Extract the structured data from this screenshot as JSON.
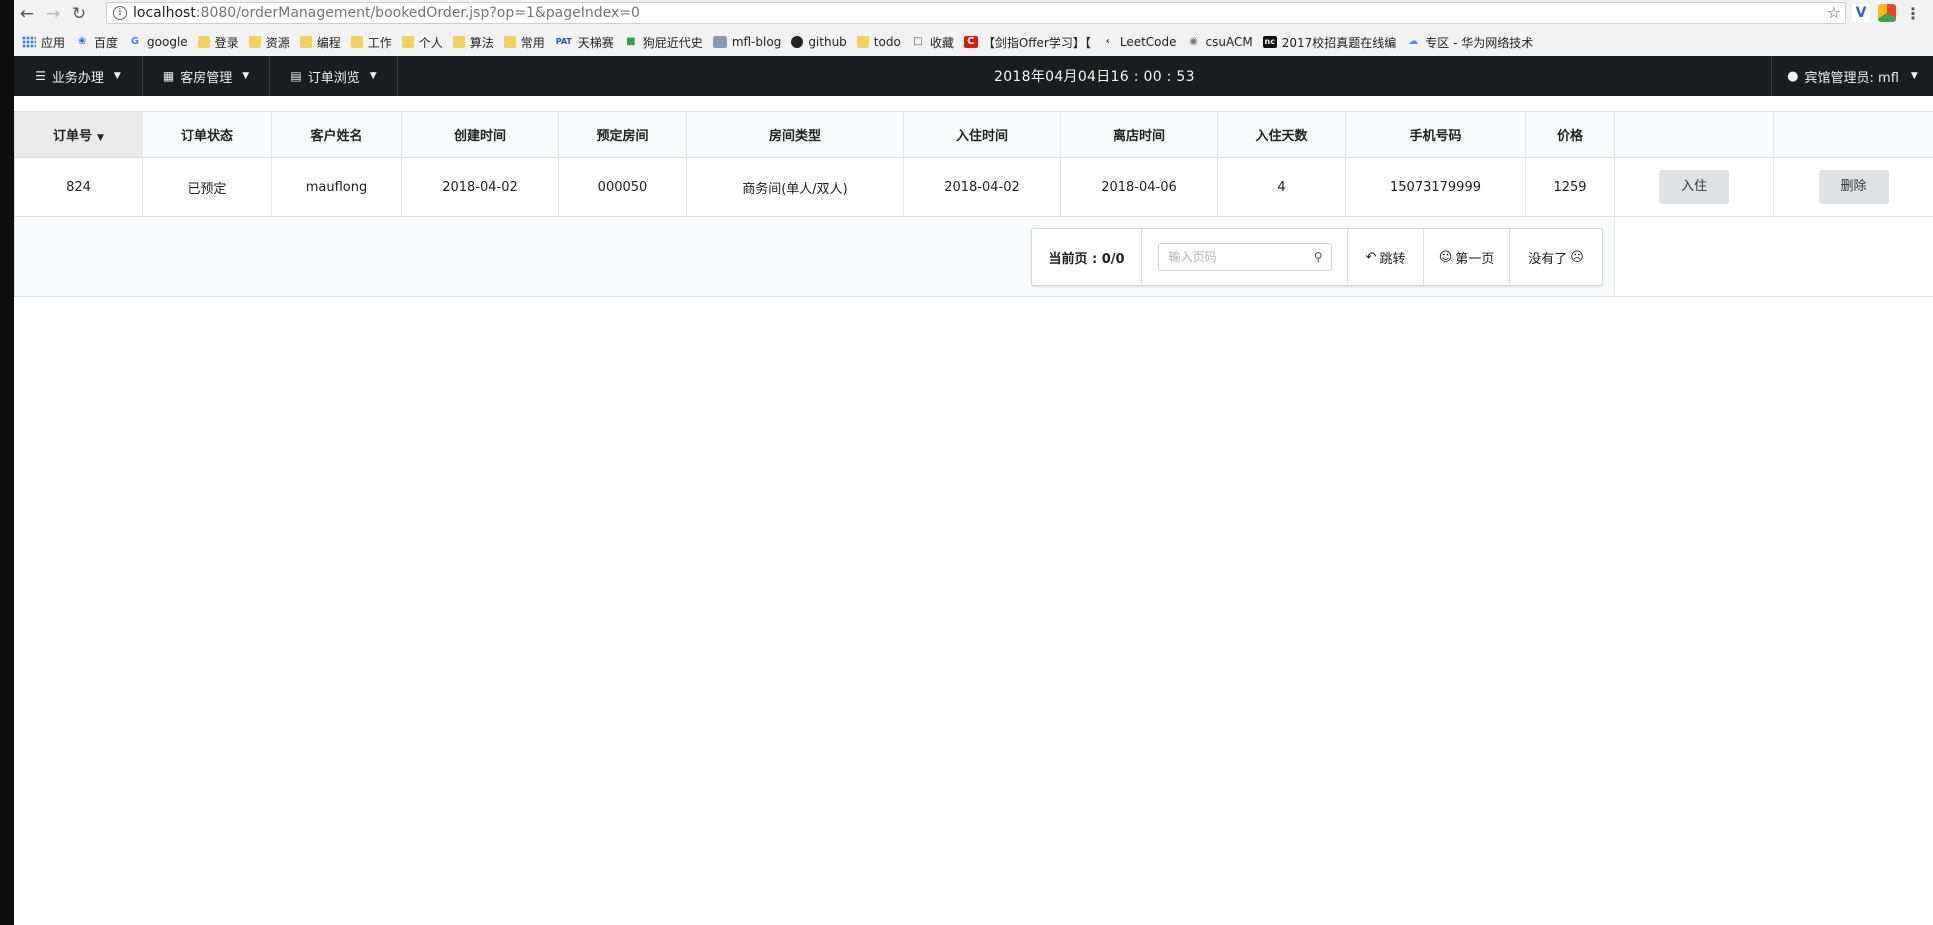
{
  "browser": {
    "url_host": "localhost",
    "url_rest": ":8080/orderManagement/bookedOrder.jsp?op=1&pageIndex=0",
    "bookmarks": [
      {
        "label": "应用",
        "icon": "apps-icon"
      },
      {
        "label": "百度",
        "icon": "baidu-icon"
      },
      {
        "label": "google",
        "icon": "google-icon"
      },
      {
        "label": "登录",
        "icon": "folder-icon"
      },
      {
        "label": "资源",
        "icon": "folder-icon"
      },
      {
        "label": "编程",
        "icon": "folder-icon"
      },
      {
        "label": "工作",
        "icon": "folder-icon"
      },
      {
        "label": "个人",
        "icon": "folder-icon"
      },
      {
        "label": "算法",
        "icon": "folder-icon"
      },
      {
        "label": "常用",
        "icon": "folder-icon"
      },
      {
        "label": "天梯赛",
        "icon": "pat-icon"
      },
      {
        "label": "狗屁近代史",
        "icon": "book-icon"
      },
      {
        "label": "mfl-blog",
        "icon": "image-icon"
      },
      {
        "label": "github",
        "icon": "github-icon"
      },
      {
        "label": "todo",
        "icon": "folder-icon"
      },
      {
        "label": "收藏",
        "icon": "open-book-icon"
      },
      {
        "label": "【剑指Offer学习】【",
        "icon": "csdn-icon"
      },
      {
        "label": "LeetCode",
        "icon": "leetcode-icon"
      },
      {
        "label": "csuACM",
        "icon": "eye-icon"
      },
      {
        "label": "2017校招真题在线编",
        "icon": "nowcoder-icon"
      },
      {
        "label": "专区 - 华为网络技术",
        "icon": "cloud-icon"
      }
    ]
  },
  "navbar": {
    "business": "业务办理",
    "rooms": "客房管理",
    "orders": "订单浏览",
    "clock": "2018年04月04日16 : 00 : 53",
    "user": "宾馆管理员: mfl"
  },
  "table": {
    "headers": [
      "订单号",
      "订单状态",
      "客户姓名",
      "创建时间",
      "预定房间",
      "房间类型",
      "入住时间",
      "离店时间",
      "入住天数",
      "手机号码",
      "价格",
      "",
      ""
    ],
    "rows": [
      {
        "cells": [
          "824",
          "已预定",
          "mauflong",
          "2018-04-02",
          "000050",
          "商务间(单人/双人)",
          "2018-04-02",
          "2018-04-06",
          "4",
          "15073179999",
          "1259"
        ],
        "checkin_label": "入住",
        "delete_label": "删除"
      }
    ]
  },
  "pager": {
    "current": "当前页 : 0/0",
    "input_placeholder": "输入页码",
    "jump": "跳转",
    "first": "第一页",
    "none": "没有了"
  }
}
